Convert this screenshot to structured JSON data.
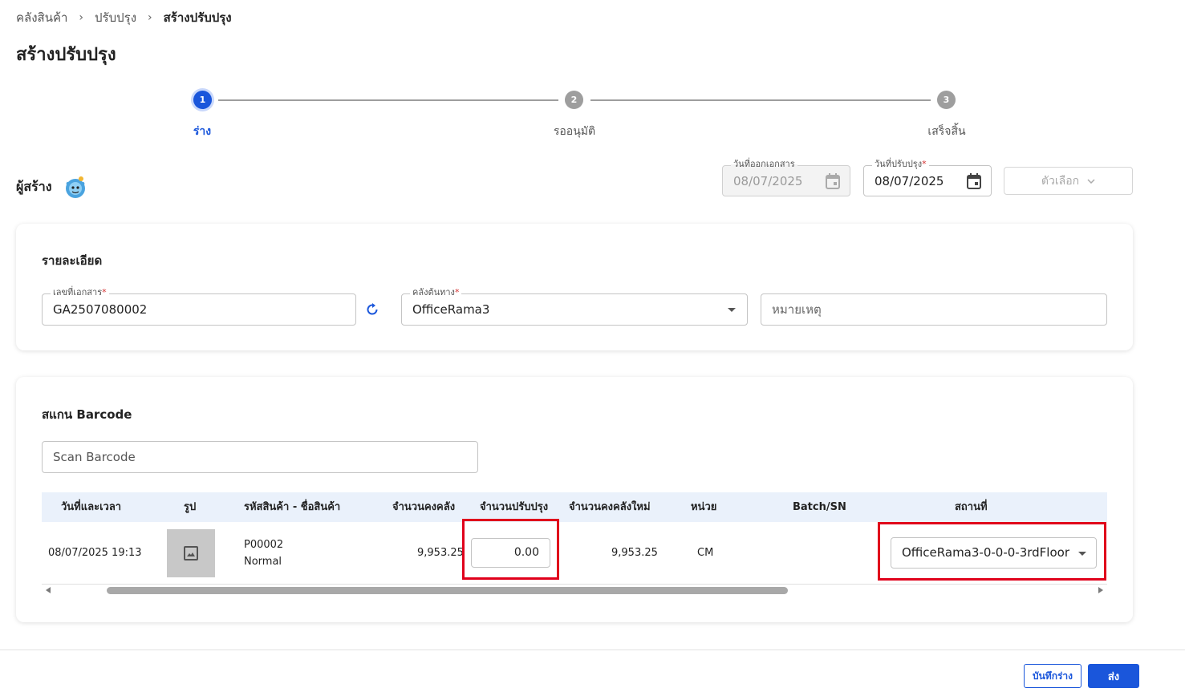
{
  "breadcrumb": {
    "items": [
      "คลังสินค้า",
      "ปรับปรุง"
    ],
    "current": "สร้างปรับปรุง",
    "separator": "›"
  },
  "page_title": "สร้างปรับปรุง",
  "stepper": {
    "steps": [
      {
        "number": "1",
        "label": "ร่าง",
        "state": "active"
      },
      {
        "number": "2",
        "label": "รออนุมัติ",
        "state": "inactive"
      },
      {
        "number": "3",
        "label": "เสร็จสิ้น",
        "state": "inactive"
      }
    ]
  },
  "creator": {
    "label": "ผู้สร้าง"
  },
  "header_fields": {
    "issue_date": {
      "label": "วันที่ออกเอกสาร",
      "value": "08/07/2025",
      "disabled": true
    },
    "adjust_date": {
      "label": "วันที่ปรับปรุง",
      "value": "08/07/2025",
      "required": "*"
    },
    "options_label": "ตัวเลือก"
  },
  "details": {
    "title": "รายละเอียด",
    "doc_number": {
      "label": "เลขที่เอกสาร",
      "value": "GA2507080002",
      "required": "*"
    },
    "source_warehouse": {
      "label": "คลังต้นทาง",
      "value": "OfficeRama3",
      "required": "*"
    },
    "remark": {
      "placeholder": "หมายเหตุ"
    }
  },
  "scan": {
    "title": "สแกน Barcode",
    "placeholder": "Scan Barcode"
  },
  "table": {
    "headers": {
      "datetime": "วันที่และเวลา",
      "image": "รูป",
      "product": "รหัสสินค้า - ชื่อสินค้า",
      "stock": "จำนวนคงคลัง",
      "adjust_qty": "จำนวนปรับปรุง",
      "new_stock": "จำนวนคงคลังใหม่",
      "unit": "หน่วย",
      "batch": "Batch/SN",
      "location": "สถานที่"
    },
    "rows": [
      {
        "datetime": "08/07/2025 19:13",
        "product_code": "P00002",
        "product_name": "Normal",
        "stock": "9,953.25",
        "adjust_qty": "0.00",
        "new_stock": "9,953.25",
        "unit": "CM",
        "batch": "",
        "location": "OfficeRama3-0-0-0-3rdFloor"
      }
    ]
  },
  "footer": {
    "save_draft": "บันทึกร่าง",
    "submit": "ส่ง"
  },
  "colors": {
    "primary": "#1a56db",
    "highlight": "#e0001b",
    "header_bg": "#eaf1fb"
  }
}
